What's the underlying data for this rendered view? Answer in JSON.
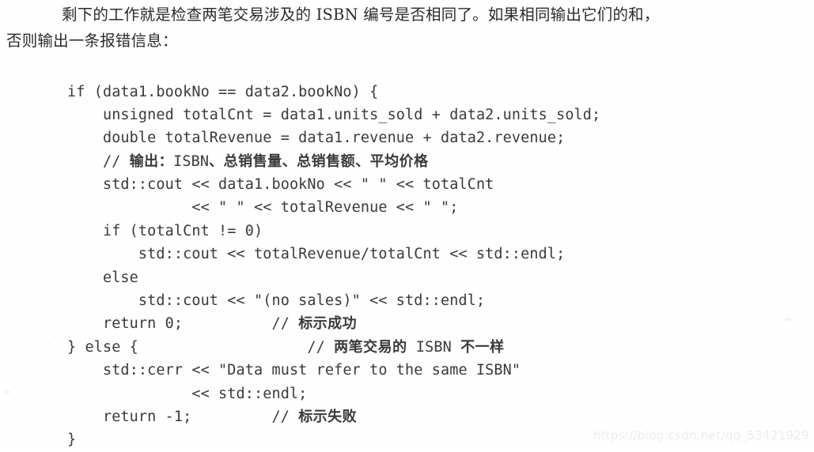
{
  "intro": {
    "line1_indent": "剩下的工作就是检查两笔交易涉及的 ISBN 编号是否相同了。如果相同输出它们的和，",
    "line2": "否则输出一条报错信息："
  },
  "code": {
    "language": "cpp",
    "lines": [
      "if (data1.bookNo == data2.bookNo) {",
      "    unsigned totalCnt = data1.units_sold + data2.units_sold;",
      "    double totalRevenue = data1.revenue + data2.revenue;",
      "    // 输出：ISBN、总销售量、总销售额、平均价格",
      "    std::cout << data1.bookNo << \" \" << totalCnt",
      "              << \" \" << totalRevenue << \" \";",
      "    if (totalCnt != 0)",
      "        std::cout << totalRevenue/totalCnt << std::endl;",
      "    else",
      "        std::cout << \"(no sales)\" << std::endl;",
      "    return 0;          // 标示成功",
      "} else {                   // 两笔交易的 ISBN 不一样",
      "    std::cerr << \"Data must refer to the same ISBN\"",
      "              << std::endl;",
      "    return -1;         // 标示失败",
      "}"
    ]
  },
  "watermark": {
    "text": "https://blog.csdn.net/qq_53421929"
  },
  "colors": {
    "page_background": "#fefefe",
    "body_text": "#2b2b2b",
    "code_text": "#3a3a3a",
    "watermark_text": "#ededed"
  }
}
